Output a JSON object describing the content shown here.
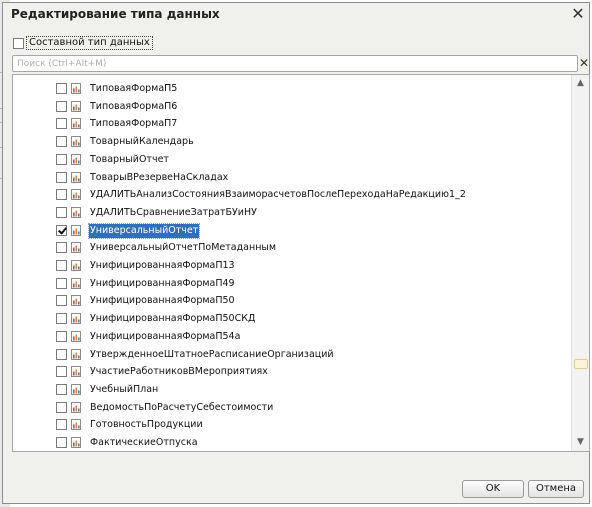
{
  "dialog": {
    "title": "Редактирование типа данных",
    "close_glyph": "✕",
    "close_icon": "close-icon"
  },
  "composite": {
    "label": "Составной тип данных",
    "checked": false
  },
  "search": {
    "placeholder": "Поиск (Ctrl+Alt+M)",
    "value": "",
    "clear_glyph": "✕"
  },
  "list": {
    "item_icon": "report-icon",
    "items": [
      {
        "label": "ТиповаяФормаП5",
        "checked": false,
        "selected": false
      },
      {
        "label": "ТиповаяФормаП6",
        "checked": false,
        "selected": false
      },
      {
        "label": "ТиповаяФормаП7",
        "checked": false,
        "selected": false
      },
      {
        "label": "ТоварныйКалендарь",
        "checked": false,
        "selected": false
      },
      {
        "label": "ТоварныйОтчет",
        "checked": false,
        "selected": false
      },
      {
        "label": "ТоварыВРезервеНаСкладах",
        "checked": false,
        "selected": false
      },
      {
        "label": "УДАЛИТЬАнализСостоянияВзаиморасчетовПослеПереходаНаРедакцию1_2",
        "checked": false,
        "selected": false
      },
      {
        "label": "УДАЛИТЬСравнениеЗатратБУиНУ",
        "checked": false,
        "selected": false
      },
      {
        "label": "УниверсальныйОтчет",
        "checked": true,
        "selected": true
      },
      {
        "label": "УниверсальныйОтчетПоМетаданным",
        "checked": false,
        "selected": false
      },
      {
        "label": "УнифицированнаяФормаП13",
        "checked": false,
        "selected": false
      },
      {
        "label": "УнифицированнаяФормаП49",
        "checked": false,
        "selected": false
      },
      {
        "label": "УнифицированнаяФормаП50",
        "checked": false,
        "selected": false
      },
      {
        "label": "УнифицированнаяФормаП50СКД",
        "checked": false,
        "selected": false
      },
      {
        "label": "УнифицированнаяФормаП54а",
        "checked": false,
        "selected": false
      },
      {
        "label": "УтвержденноеШтатноеРасписаниеОрганизаций",
        "checked": false,
        "selected": false
      },
      {
        "label": "УчастиеРаботниковВМероприятиях",
        "checked": false,
        "selected": false
      },
      {
        "label": "УчебныйПлан",
        "checked": false,
        "selected": false
      },
      {
        "label": "ВедомостьПоРасчетуСебестоимости",
        "checked": false,
        "selected": false
      },
      {
        "label": "ГотовностьПродукции",
        "checked": false,
        "selected": false
      },
      {
        "label": "ФактическиеОтпуска",
        "checked": false,
        "selected": false
      }
    ]
  },
  "scrollbar": {
    "up_glyph": "▲",
    "down_glyph": "▼",
    "position": 0.8
  },
  "buttons": {
    "ok": "OK",
    "cancel": "Отмена"
  }
}
